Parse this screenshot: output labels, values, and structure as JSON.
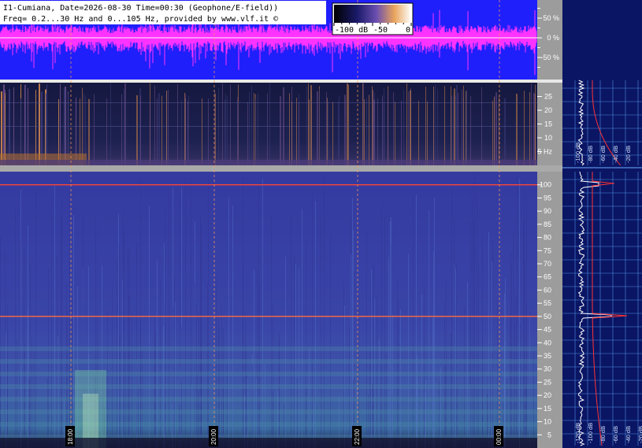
{
  "header": {
    "line1": "I1-Cumiana, Date=2026-08-30 Time=00:30 (Geophone/E-field))",
    "line2": "Freq= 0.2...30 Hz and 0...105 Hz, provided by www.vlf.it ©"
  },
  "colorbar": {
    "labels": [
      "-100 dB",
      "-50",
      "0"
    ]
  },
  "time_labels": [
    "18:00",
    "20:00",
    "22:00",
    "00:00"
  ],
  "amplitude_axis": {
    "ticks": [
      "50 %",
      "0 %",
      "-50 %"
    ]
  },
  "spectrum_panel": {
    "top_db_labels": [
      "-100 dB",
      "-80 dB",
      "-60 dB",
      "-40 dB",
      "-20 dB"
    ],
    "bottom_db_labels": [
      "-120 dB",
      "-100 dB",
      "-80 dB",
      "-60 dB",
      "-40 dB",
      "-20 dB"
    ]
  },
  "chart_data": [
    {
      "type": "line",
      "name": "waveform",
      "xlabel": "",
      "ylabel": "",
      "y_ticks": [
        "50 %",
        "0 %",
        "-50 %"
      ],
      "x_ticks": [
        "18:00",
        "20:00",
        "22:00",
        "00:00"
      ],
      "colors": {
        "background": "#1f1ffb",
        "trace": "#ff33ff"
      }
    },
    {
      "type": "heatmap",
      "name": "low-frequency spectrogram",
      "ylim": [
        0,
        30
      ],
      "y_ticks": [
        5,
        10,
        15,
        20,
        25
      ],
      "y_tick_labels": [
        "5 Hz",
        "10",
        "15",
        "20",
        "25"
      ],
      "x_ticks": [
        "18:00",
        "20:00",
        "22:00",
        "00:00"
      ]
    },
    {
      "type": "heatmap",
      "name": "wide spectrogram",
      "ylim": [
        0,
        105
      ],
      "y_ticks": [
        5,
        10,
        15,
        20,
        25,
        30,
        35,
        40,
        45,
        50,
        55,
        60,
        65,
        70,
        75,
        80,
        85,
        90,
        95,
        100
      ],
      "x_ticks": [
        "18:00",
        "20:00",
        "22:00",
        "00:00"
      ],
      "highlights": [
        {
          "freq": 50,
          "color": "#ff6a3a"
        },
        {
          "freq": 100,
          "color": "#ff4433"
        }
      ]
    }
  ],
  "colors": {
    "spectrogram_bg": "#363aa0",
    "waveform_bg": "#1f1ffb",
    "trace": "#ff33ff",
    "axis_panel": "#9c9c9c",
    "side_panel": "#0a1564",
    "time_marker": "#ff9a55"
  }
}
